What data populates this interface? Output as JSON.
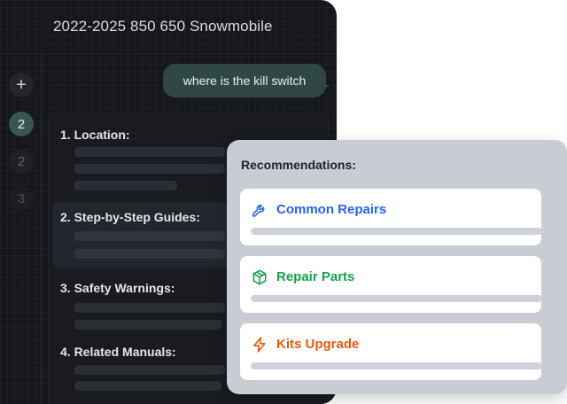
{
  "window": {
    "title": "2022-2025 850 650 Snowmobile"
  },
  "sidebar": {
    "new_chat_icon": "+",
    "items": [
      {
        "label": "2"
      },
      {
        "label": "2"
      },
      {
        "label": "3"
      }
    ]
  },
  "chat": {
    "user_message": "where is the kill switch",
    "sections": [
      {
        "title": "1. Location:"
      },
      {
        "title": "2. Step-by-Step Guides:"
      },
      {
        "title": "3. Safety Warnings:"
      },
      {
        "title": "4. Related Manuals:"
      }
    ]
  },
  "recommendations": {
    "title": "Recommendations:",
    "items": [
      {
        "label": "Common Repairs",
        "icon": "wrench-icon",
        "color": "#2563eb"
      },
      {
        "label": "Repair Parts",
        "icon": "box-icon",
        "color": "#16a34a"
      },
      {
        "label": "Kits Upgrade",
        "icon": "lightning-icon",
        "color": "#ea580c"
      }
    ]
  },
  "colors": {
    "window_bg": "#16171c",
    "accent_green": "#2f4845",
    "panel_bg": "#c9ccd3"
  }
}
